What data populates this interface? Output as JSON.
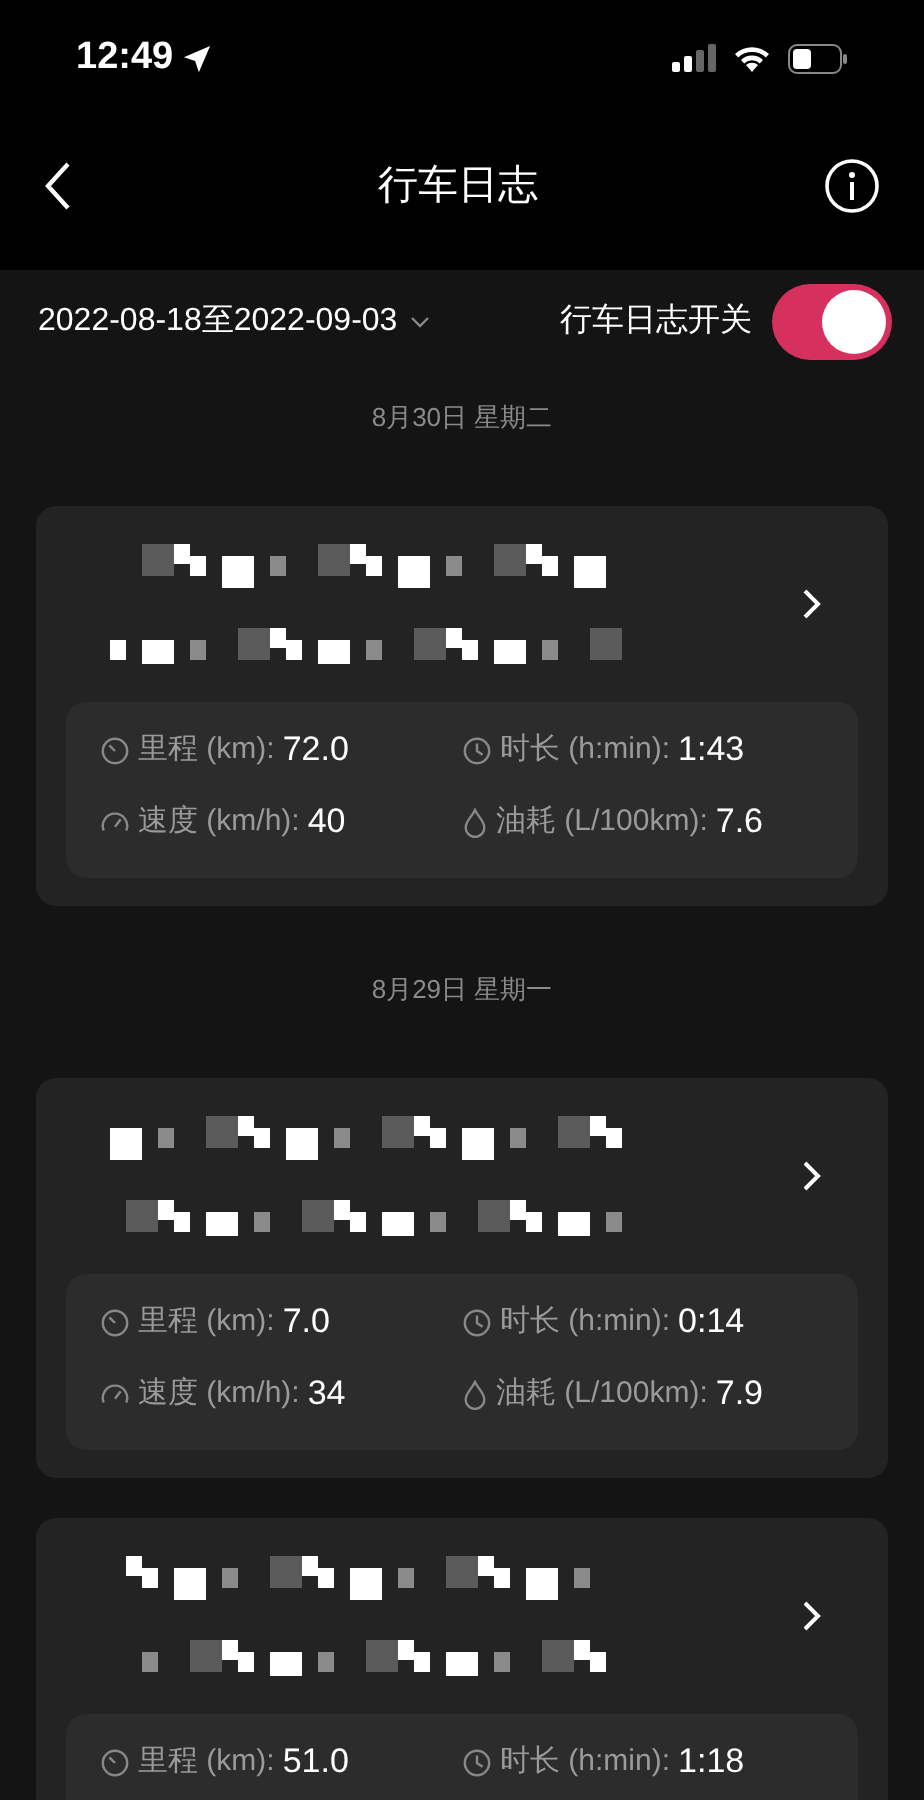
{
  "status_bar": {
    "time": "12:49"
  },
  "nav": {
    "title": "行车日志"
  },
  "filter": {
    "date_range": "2022-08-18至2022-09-03",
    "switch_label": "行车日志开关",
    "switch_on": true
  },
  "days": [
    {
      "date": "8月30日 星期二",
      "trips": [
        {
          "stats": [
            {
              "kind": "distance",
              "label": "里程 (km):",
              "value": "72.0"
            },
            {
              "kind": "duration",
              "label": "时长 (h:min):",
              "value": "1:43"
            },
            {
              "kind": "speed",
              "label": "速度 (km/h):",
              "value": "40"
            },
            {
              "kind": "fuel",
              "label": "油耗 (L/100km):",
              "value": "7.6"
            }
          ]
        }
      ]
    },
    {
      "date": "8月29日 星期一",
      "trips": [
        {
          "stats": [
            {
              "kind": "distance",
              "label": "里程 (km):",
              "value": "7.0"
            },
            {
              "kind": "duration",
              "label": "时长 (h:min):",
              "value": "0:14"
            },
            {
              "kind": "speed",
              "label": "速度 (km/h):",
              "value": "34"
            },
            {
              "kind": "fuel",
              "label": "油耗 (L/100km):",
              "value": "7.9"
            }
          ]
        },
        {
          "stats": [
            {
              "kind": "distance",
              "label": "里程 (km):",
              "value": "51.0"
            },
            {
              "kind": "duration",
              "label": "时长 (h:min):",
              "value": "1:18"
            }
          ]
        }
      ]
    }
  ]
}
